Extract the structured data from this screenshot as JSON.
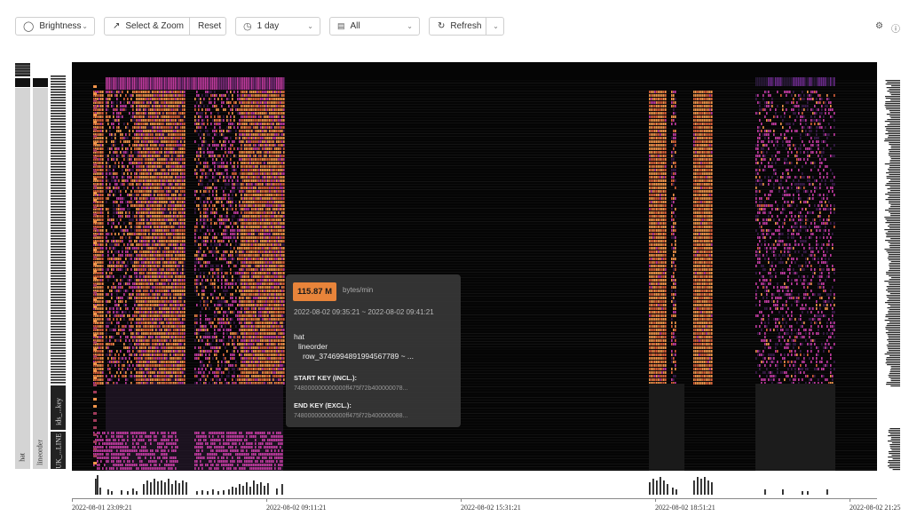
{
  "toolbar": {
    "brightness_label": "Brightness",
    "select_zoom_label": "Select & Zoom",
    "reset_label": "Reset",
    "time_range_value": "1 day",
    "metric_value": "All",
    "refresh_label": "Refresh"
  },
  "left_axis": {
    "col1_label": "hat",
    "col2_label": "lineorder",
    "col3_label_top": "ids_...key",
    "col3_label_bottom": "UK_...LINE"
  },
  "time_axis": {
    "ticks": [
      "2022-08-01 23:09:21",
      "2022-08-02 09:11:21",
      "2022-08-02 15:31:21",
      "2022-08-02 18:51:21",
      "2022-08-02 21:25"
    ]
  },
  "tooltip": {
    "value": "115.87 M",
    "unit": "bytes/min",
    "range": "2022-08-02 09:35:21 ~ 2022-08-02 09:41:21",
    "path_db": "hat",
    "path_table": "lineorder",
    "path_row": "row_3746994891994567789 ~ ...",
    "start_key_label": "START KEY (INCL.):",
    "start_key_value": "748000000000000ff475f72b400000078...",
    "end_key_label": "END KEY (EXCL.):",
    "end_key_value": "748000000000000ff475f72b400000088..."
  },
  "colors": {
    "heat_hot": "#f0944a",
    "heat_mid": "#c03aa0",
    "heat_low": "#3a1a4a",
    "background": "#050505"
  }
}
